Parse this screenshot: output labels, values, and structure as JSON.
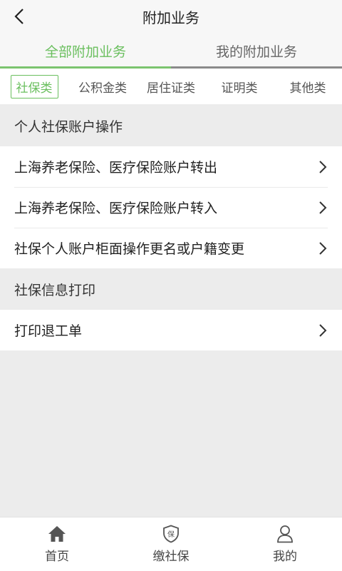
{
  "header": {
    "title": "附加业务",
    "back_icon": "chevron-left-icon"
  },
  "tabs": [
    {
      "label": "全部附加业务",
      "active": true
    },
    {
      "label": "我的附加业务",
      "active": false
    }
  ],
  "categories": [
    {
      "label": "社保类",
      "active": true
    },
    {
      "label": "公积金类",
      "active": false
    },
    {
      "label": "居住证类",
      "active": false
    },
    {
      "label": "证明类",
      "active": false
    },
    {
      "label": "其他类",
      "active": false
    }
  ],
  "sections": [
    {
      "title": "个人社保账户操作",
      "items": [
        "上海养老保险、医疗保险账户转出",
        "上海养老保险、医疗保险账户转入",
        "社保个人账户柜面操作更名或户籍变更"
      ]
    },
    {
      "title": "社保信息打印",
      "items": [
        "打印退工单"
      ]
    }
  ],
  "bottom_nav": [
    {
      "label": "首页",
      "icon": "home-icon"
    },
    {
      "label": "缴社保",
      "icon": "shield-icon",
      "icon_text": "保"
    },
    {
      "label": "我的",
      "icon": "user-icon"
    }
  ],
  "colors": {
    "accent": "#6abf5e",
    "background": "#ececec"
  }
}
